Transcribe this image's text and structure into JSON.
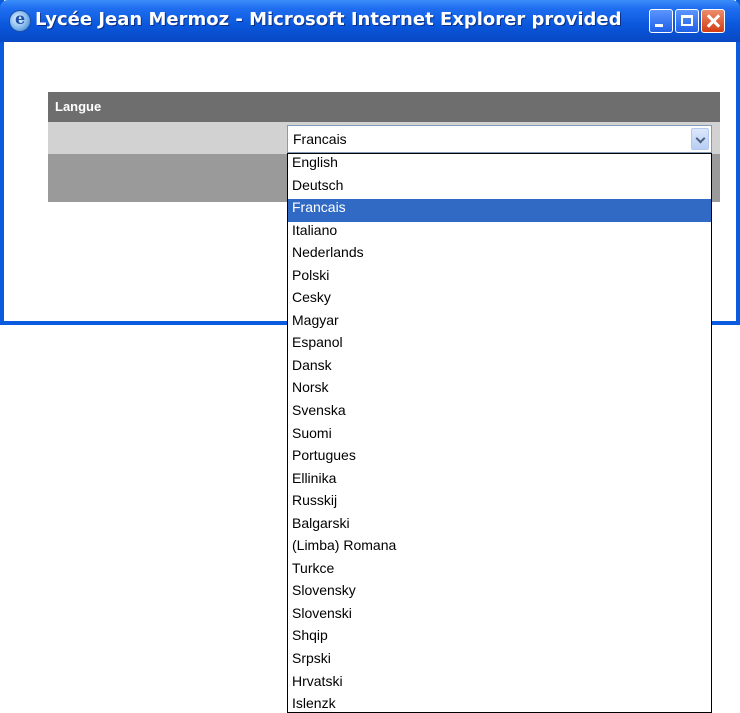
{
  "window": {
    "title": "Lycée Jean Mermoz - Microsoft Internet Explorer provided by ..."
  },
  "panel": {
    "header": "Langue"
  },
  "language_select": {
    "selected": "Francais",
    "options": [
      "English",
      "Deutsch",
      "Francais",
      "Italiano",
      "Nederlands",
      "Polski",
      "Cesky",
      "Magyar",
      "Espanol",
      "Dansk",
      "Norsk",
      "Svenska",
      "Suomi",
      "Portugues",
      "Ellinika",
      "Russkij",
      "Balgarski",
      "(Limba) Romana",
      "Turkce",
      "Slovensky",
      "Slovenski",
      "Shqip",
      "Srpski",
      "Hrvatski",
      "Islenzk"
    ]
  },
  "colors": {
    "titlebar": "#0a57dc",
    "header_bg": "#6e6e6e",
    "selection": "#316ac5"
  },
  "icons": [
    "ie-icon",
    "minimize-icon",
    "maximize-icon",
    "close-icon",
    "chevron-down-icon"
  ]
}
